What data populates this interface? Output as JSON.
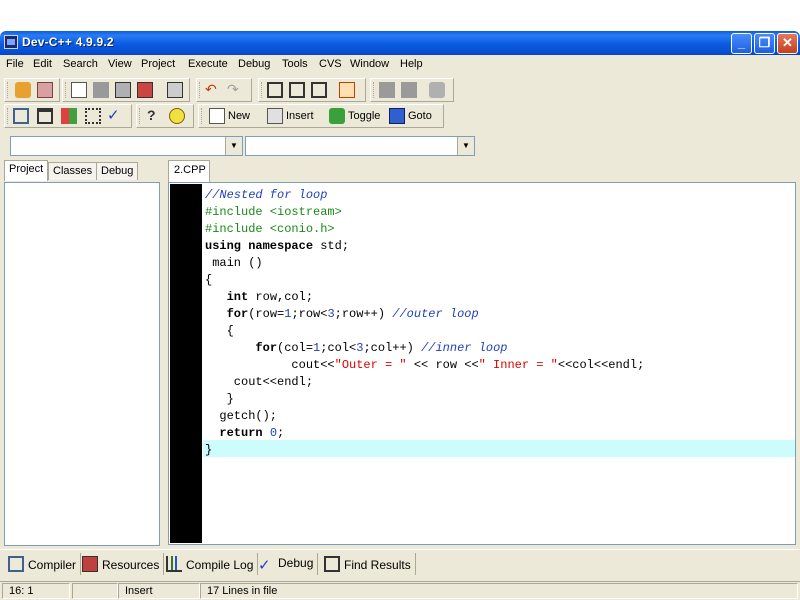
{
  "window": {
    "title": "Dev-C++ 4.9.9.2"
  },
  "menu": [
    "File",
    "Edit",
    "Search",
    "View",
    "Project",
    "Execute",
    "Debug",
    "Tools",
    "CVS",
    "Window",
    "Help"
  ],
  "toolbar": {
    "new_label": "New",
    "insert_label": "Insert",
    "toggle_label": "Toggle",
    "goto_label": "Goto"
  },
  "combos": {
    "class_value": "",
    "member_value": ""
  },
  "left_tabs": [
    "Project",
    "Classes",
    "Debug"
  ],
  "editor": {
    "file_tab": "2.CPP",
    "lines": [
      "//Nested for loop",
      "#include <iostream>",
      "#include <conio.h>",
      "using namespace std;",
      " main ()",
      "{",
      "   int row,col;",
      "   for(row=1;row<3;row++) //outer loop",
      "   {",
      "       for(col=1;col<3;col++) //inner loop",
      "            cout<<\"Outer = \" << row <<\" Inner = \"<<col<<endl;",
      "    cout<<endl;",
      "   }",
      "  getch();",
      "  return 0;",
      "}"
    ]
  },
  "bottom_tabs": [
    "Compiler",
    "Resources",
    "Compile Log",
    "Debug",
    "Find Results"
  ],
  "status": {
    "position": "16: 1",
    "blank": "",
    "mode": "Insert",
    "info": "17 Lines in file"
  },
  "colors": {
    "titlebar": "#0a5ee0",
    "comment": "#1f3fbf",
    "preprocessor": "#1a8a1a",
    "string": "#e00000",
    "current_line": "#ccfcfc"
  }
}
